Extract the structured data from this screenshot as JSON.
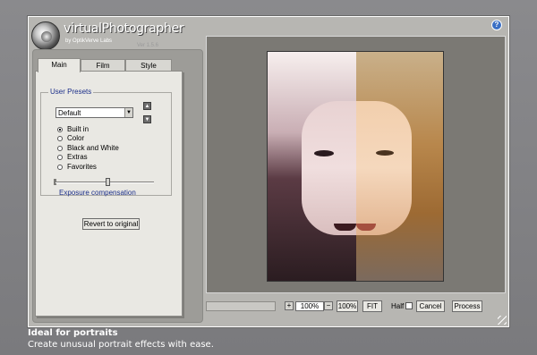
{
  "app": {
    "title": "virtualPhotographer",
    "subtitle": "by OptikVerve Labs",
    "version": "Ver 1.5.6",
    "help_label": "?"
  },
  "tabs": [
    {
      "label": "Main",
      "active": true
    },
    {
      "label": "Film",
      "active": false
    },
    {
      "label": "Style",
      "active": false
    }
  ],
  "user_presets": {
    "group_label": "User Presets",
    "selected": "Default",
    "options": [
      {
        "label": "Built in",
        "checked": true
      },
      {
        "label": "Color",
        "checked": false
      },
      {
        "label": "Black and White",
        "checked": false
      },
      {
        "label": "Extras",
        "checked": false
      },
      {
        "label": "Favorites",
        "checked": false
      }
    ]
  },
  "exposure": {
    "label": "Exposure compensation",
    "level": 0.53
  },
  "buttons": {
    "revert": "Revert to original",
    "zoom_plus": "+",
    "zoom_minus": "−",
    "zoom_100": "100%",
    "fit": "FIT",
    "cancel": "Cancel",
    "process": "Process"
  },
  "zoom": {
    "value": "100%"
  },
  "half": {
    "label": "Half",
    "checked": false
  },
  "caption": {
    "title": "Ideal for portraits",
    "text": "Create unusual portrait effects with ease."
  },
  "colors": {
    "window_bg": "#b7b6b2",
    "panel_bg": "#e9e8e3",
    "label_blue": "#1c2f8a",
    "image_frame_bg": "#7b7974"
  }
}
